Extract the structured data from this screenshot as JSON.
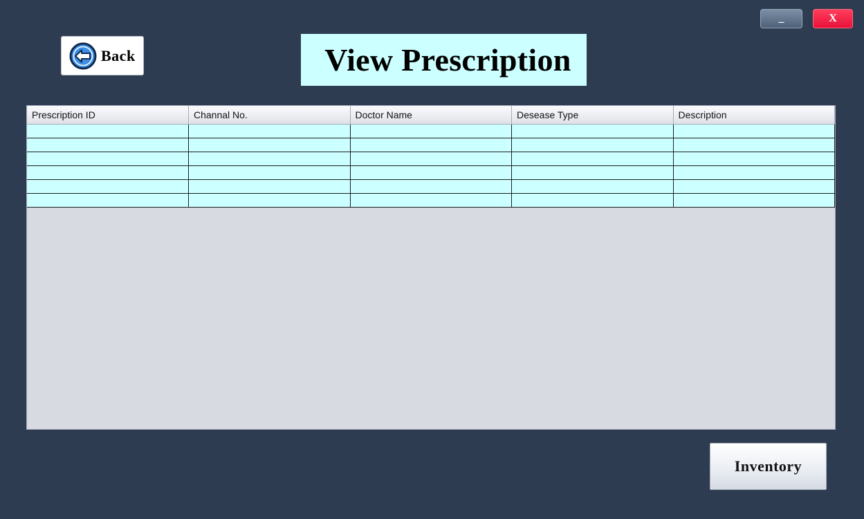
{
  "window": {
    "minimize_label": "_",
    "close_label": "X",
    "close_color": "#ee1b42",
    "background_color": "#2e3c51"
  },
  "back_button": {
    "label": "Back",
    "icon": "left-arrow-circle-icon",
    "icon_color": "#3c8fe8"
  },
  "page_title": "View Prescription",
  "table": {
    "columns": [
      "Prescription ID",
      "Channal No.",
      "Doctor Name",
      "Desease Type",
      "Description"
    ],
    "rows": [
      [
        "",
        "",
        "",
        "",
        ""
      ],
      [
        "",
        "",
        "",
        "",
        ""
      ],
      [
        "",
        "",
        "",
        "",
        ""
      ],
      [
        "",
        "",
        "",
        "",
        ""
      ],
      [
        "",
        "",
        "",
        "",
        ""
      ],
      [
        "",
        "",
        "",
        "",
        ""
      ]
    ],
    "row_color": "#ccffff"
  },
  "inventory_button": {
    "label": "Inventory"
  }
}
